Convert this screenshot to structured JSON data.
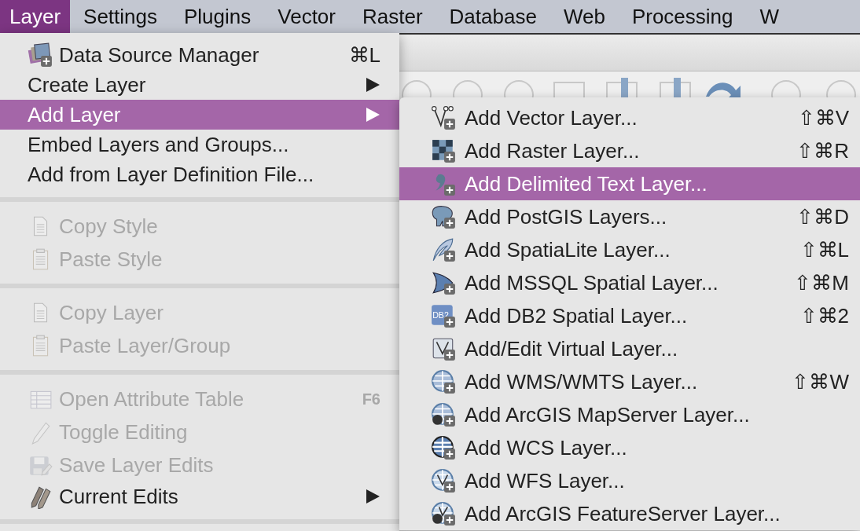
{
  "menubar": [
    {
      "label": "Layer",
      "selected": true
    },
    {
      "label": "Settings",
      "selected": false
    },
    {
      "label": "Plugins",
      "selected": false
    },
    {
      "label": "Vector",
      "selected": false
    },
    {
      "label": "Raster",
      "selected": false
    },
    {
      "label": "Database",
      "selected": false
    },
    {
      "label": "Web",
      "selected": false
    },
    {
      "label": "Processing",
      "selected": false
    },
    {
      "label": "W",
      "selected": false
    }
  ],
  "layer_menu": {
    "sections": [
      [
        {
          "label": "Data Source Manager",
          "shortcut": "⌘L",
          "submenu": false,
          "disabled": false,
          "selected": false
        },
        {
          "label": "Create Layer",
          "submenu": true,
          "disabled": false,
          "selected": false
        },
        {
          "label": "Add Layer",
          "submenu": true,
          "disabled": false,
          "selected": true
        },
        {
          "label": "Embed Layers and Groups...",
          "submenu": false,
          "disabled": false,
          "selected": false
        },
        {
          "label": "Add from Layer Definition File...",
          "submenu": false,
          "disabled": false,
          "selected": false
        }
      ],
      [
        {
          "label": "Copy Style",
          "submenu": false,
          "disabled": true,
          "selected": false
        },
        {
          "label": "Paste Style",
          "submenu": false,
          "disabled": true,
          "selected": false
        }
      ],
      [
        {
          "label": "Copy Layer",
          "submenu": false,
          "disabled": true,
          "selected": false
        },
        {
          "label": "Paste Layer/Group",
          "submenu": false,
          "disabled": true,
          "selected": false
        }
      ],
      [
        {
          "label": "Open Attribute Table",
          "shortcut": "F6",
          "submenu": false,
          "disabled": true,
          "selected": false
        },
        {
          "label": "Toggle Editing",
          "submenu": false,
          "disabled": true,
          "selected": false
        },
        {
          "label": "Save Layer Edits",
          "submenu": false,
          "disabled": true,
          "selected": false
        },
        {
          "label": "Current Edits",
          "submenu": true,
          "disabled": false,
          "selected": false
        }
      ]
    ]
  },
  "add_layer_submenu": {
    "items": [
      {
        "label": "Add Vector Layer...",
        "shortcut": "⇧⌘V",
        "selected": false
      },
      {
        "label": "Add Raster Layer...",
        "shortcut": "⇧⌘R",
        "selected": false
      },
      {
        "label": "Add Delimited Text Layer...",
        "selected": true
      },
      {
        "label": "Add PostGIS Layers...",
        "shortcut": "⇧⌘D",
        "selected": false
      },
      {
        "label": "Add SpatiaLite Layer...",
        "shortcut": "⇧⌘L",
        "selected": false
      },
      {
        "label": "Add MSSQL Spatial Layer...",
        "shortcut": "⇧⌘M",
        "selected": false
      },
      {
        "label": "Add DB2 Spatial Layer...",
        "shortcut": "⇧⌘2",
        "icon_text": "DB2",
        "selected": false
      },
      {
        "label": "Add/Edit Virtual Layer...",
        "selected": false
      },
      {
        "label": "Add WMS/WMTS Layer...",
        "shortcut": "⇧⌘W",
        "selected": false
      },
      {
        "label": "Add ArcGIS MapServer Layer...",
        "selected": false
      },
      {
        "label": "Add WCS Layer...",
        "selected": false
      },
      {
        "label": "Add WFS Layer...",
        "selected": false
      },
      {
        "label": "Add ArcGIS FeatureServer Layer...",
        "selected": false
      }
    ]
  }
}
